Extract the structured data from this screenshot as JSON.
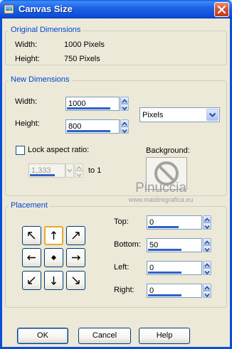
{
  "window": {
    "title": "Canvas Size"
  },
  "original_dimensions": {
    "label": "Original Dimensions",
    "width_label": "Width:",
    "width_value": "1000 Pixels",
    "height_label": "Height:",
    "height_value": "750 Pixels"
  },
  "new_dimensions": {
    "label": "New Dimensions",
    "width_label": "Width:",
    "width_value": "1000",
    "height_label": "Height:",
    "height_value": "800",
    "units_value": "Pixels",
    "lock_label": "Lock aspect ratio:",
    "lock_checked": false,
    "ratio_value": "1,333",
    "ratio_suffix": "to 1",
    "background_label": "Background:"
  },
  "watermark": {
    "text": "Pinuccia",
    "url": "www.maidiregrafica.eu"
  },
  "placement": {
    "label": "Placement",
    "active_anchor": "top-center",
    "anchors": [
      "top-left",
      "top-center",
      "top-right",
      "middle-left",
      "center",
      "middle-right",
      "bottom-left",
      "bottom-center",
      "bottom-right"
    ],
    "top_label": "Top:",
    "top_value": "0",
    "bottom_label": "Bottom:",
    "bottom_value": "50",
    "left_label": "Left:",
    "left_value": "0",
    "right_label": "Right:",
    "right_value": "0"
  },
  "buttons": {
    "ok": "OK",
    "cancel": "Cancel",
    "help": "Help"
  },
  "colors": {
    "title_bar": "#0b4ed8",
    "group_label": "#0046d5",
    "dialog_bg": "#ece9d8",
    "accent_bar": "#2e62c8",
    "active_anchor_border": "#e8a82c"
  }
}
